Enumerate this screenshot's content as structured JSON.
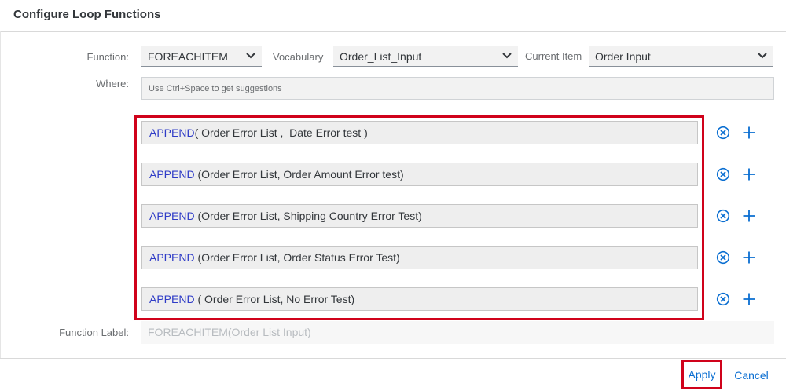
{
  "dialog": {
    "title": "Configure Loop Functions"
  },
  "form": {
    "function_label": "Function:",
    "function_value": "FOREACHITEM",
    "vocabulary_label": "Vocabulary",
    "vocabulary_value": "Order_List_Input",
    "current_item_label": "Current Item",
    "current_item_value": "Order Input",
    "where_label": "Where:",
    "where_placeholder": "Use Ctrl+Space to get suggestions",
    "function_label_label": "Function Label:",
    "function_label_value": "FOREACHITEM(Order List Input)"
  },
  "expressions": [
    {
      "keyword": "APPEND",
      "rest": "( Order Error List ,  Date Error test )"
    },
    {
      "keyword": "APPEND",
      "rest": " (Order Error List, Order Amount Error test)"
    },
    {
      "keyword": "APPEND",
      "rest": " (Order Error List, Shipping Country Error Test)"
    },
    {
      "keyword": "APPEND",
      "rest": " (Order Error List, Order Status Error Test)"
    },
    {
      "keyword": "APPEND",
      "rest": " ( Order Error List, No Error Test)"
    }
  ],
  "icons": {
    "remove": "remove-circle-icon",
    "add": "plus-icon",
    "dropdown": "chevron-down-icon"
  },
  "footer": {
    "apply_label": "Apply",
    "cancel_label": "Cancel"
  },
  "colors": {
    "accent": "#0a6ed1",
    "keyword": "#2f3cc7",
    "highlight": "#d0021b"
  }
}
